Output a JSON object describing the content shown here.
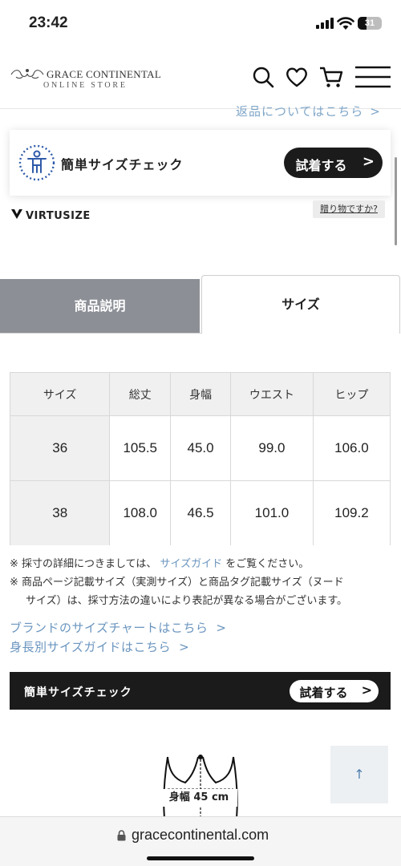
{
  "status_bar": {
    "time": "23:42",
    "battery": "31"
  },
  "header": {
    "brand_name": "GRACE CONTINENTAL",
    "brand_sub": "ONLINE STORE",
    "icons": [
      "search-icon",
      "heart-icon",
      "cart-icon",
      "menu-icon"
    ]
  },
  "returns_link": {
    "label": "返品についてはこちら"
  },
  "virtusize": {
    "check_label": "簡単サイズチェック",
    "try_button": "試着する",
    "brand": "VIRTUSIZE",
    "gift_link": "贈り物ですか?"
  },
  "tabs": [
    {
      "label": "商品説明",
      "active": false
    },
    {
      "label": "サイズ",
      "active": true
    }
  ],
  "size_table": {
    "headers": [
      "サイズ",
      "総丈",
      "身幅",
      "ウエスト",
      "ヒップ"
    ],
    "rows": [
      [
        "36",
        "105.5",
        "45.0",
        "99.0",
        "106.0"
      ],
      [
        "38",
        "108.0",
        "46.5",
        "101.0",
        "109.2"
      ]
    ]
  },
  "notes": {
    "note1_prefix": "※ 採寸の詳細につきましては、",
    "note1_link": "サイズガイド",
    "note1_suffix": "をご覧ください。",
    "note2_line1": "※ 商品ページ記載サイズ（実測サイズ）と商品タグ記載サイズ（ヌード",
    "note2_line2": "サイズ）は、採寸方法の違いにより表記が異なる場合がございます。"
  },
  "links": {
    "brand_size_chart": "ブランドのサイズチャートはこちら",
    "height_size_guide": "身長別サイズガイドはこちら"
  },
  "sticky_bar": {
    "label": "簡単サイズチェック",
    "button": "試着する"
  },
  "garment_diagram": {
    "measure_label": "身幅 45 cm"
  },
  "browser": {
    "url": "gracecontinental.com"
  },
  "colors": {
    "link_blue": "#6a95bf",
    "dark": "#1b1b1b",
    "tab_inactive": "#8c8f96"
  }
}
